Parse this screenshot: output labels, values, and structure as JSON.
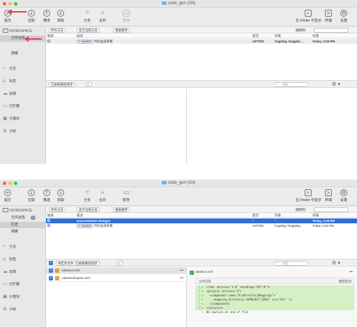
{
  "window_title": "code_gen (Git)",
  "colors": {
    "close": "#fc605c",
    "minimize": "#fdbc40",
    "zoom": "#34c84a",
    "accent": "#2f6fd6",
    "annotation_arrow": "#e8375b",
    "diff_added": "#d6f0c6"
  },
  "toolbar": {
    "commit": "提交",
    "pull": "拉取",
    "push": "推送",
    "fetch": "抓取",
    "branch": "分支",
    "merge": "合并",
    "stash": "暂存",
    "show_in_finder": "在 Finder 中显示",
    "terminal": "终端",
    "settings": "设置"
  },
  "sidebar": {
    "workspace": "WORKSPACE",
    "file_status": "文件状态",
    "history": "历史",
    "search": "搜索",
    "badge_count": "3",
    "sections": {
      "branches": "分支",
      "tags": "标签",
      "remotes": "远端",
      "stashes": "已贮藏",
      "submodules": "子模块",
      "subtrees": "子树"
    }
  },
  "filters": {
    "all_branches": "所有分支",
    "show_remote": "显示远程分支",
    "order": "祖级顺序",
    "jump_to": "跳转到："
  },
  "table_headers": {
    "graph": "图表",
    "description": "描述",
    "commit": "提交",
    "author": "作者",
    "date": "日期"
  },
  "win1": {
    "rows": [
      {
        "branch": "master",
        "message": "代码生成项目",
        "commit": "c97f7b0",
        "author": "hugebig <hugebi...",
        "date": "Today, 3:25 PM"
      }
    ],
    "bottom_sort": "已依照路径排序",
    "search_placeholder": "搜索"
  },
  "win2": {
    "uncommitted": {
      "label": "Uncommitted changes",
      "commit": "*",
      "author": "*",
      "date": "Today, 3:28 PM"
    },
    "row": {
      "branch": "master",
      "message": "代码生成项目",
      "commit": "c97f7b0",
      "author": "hugebig <hugebig...",
      "date": "Today, 3:25 PM"
    },
    "staged_sort": "待定的文件, 已依照路径排序",
    "search_placeholder": "搜索",
    "files": [
      {
        "name": ".idea/vcs.xml",
        "more": "•••"
      },
      {
        "name": ".idea/workspace.xml",
        "more": "•••"
      }
    ],
    "diff": {
      "file": ".idea/vcs.xml",
      "more": "•••",
      "hunk_label": "文件内容",
      "hunk_button": "暂存区块",
      "lines": [
        {
          "n": "1",
          "sign": "+",
          "text": "<?xml version=\"1.0\" encoding=\"UTF-8\"?>"
        },
        {
          "n": "2",
          "sign": "+",
          "text": "<project version=\"4\">"
        },
        {
          "n": "3",
          "sign": "+",
          "text": "  <component name=\"VcsDirectoryMappings\">"
        },
        {
          "n": "4",
          "sign": "+",
          "text": "    <mapping directory=\"$PROJECT_DIR$\" vcs=\"Git\" />"
        },
        {
          "n": "5",
          "sign": "+",
          "text": "  </component>"
        },
        {
          "n": "6",
          "sign": "+",
          "text": "</project>"
        },
        {
          "n": "",
          "sign": "\\",
          "text": "No newline at end of file"
        }
      ]
    }
  }
}
